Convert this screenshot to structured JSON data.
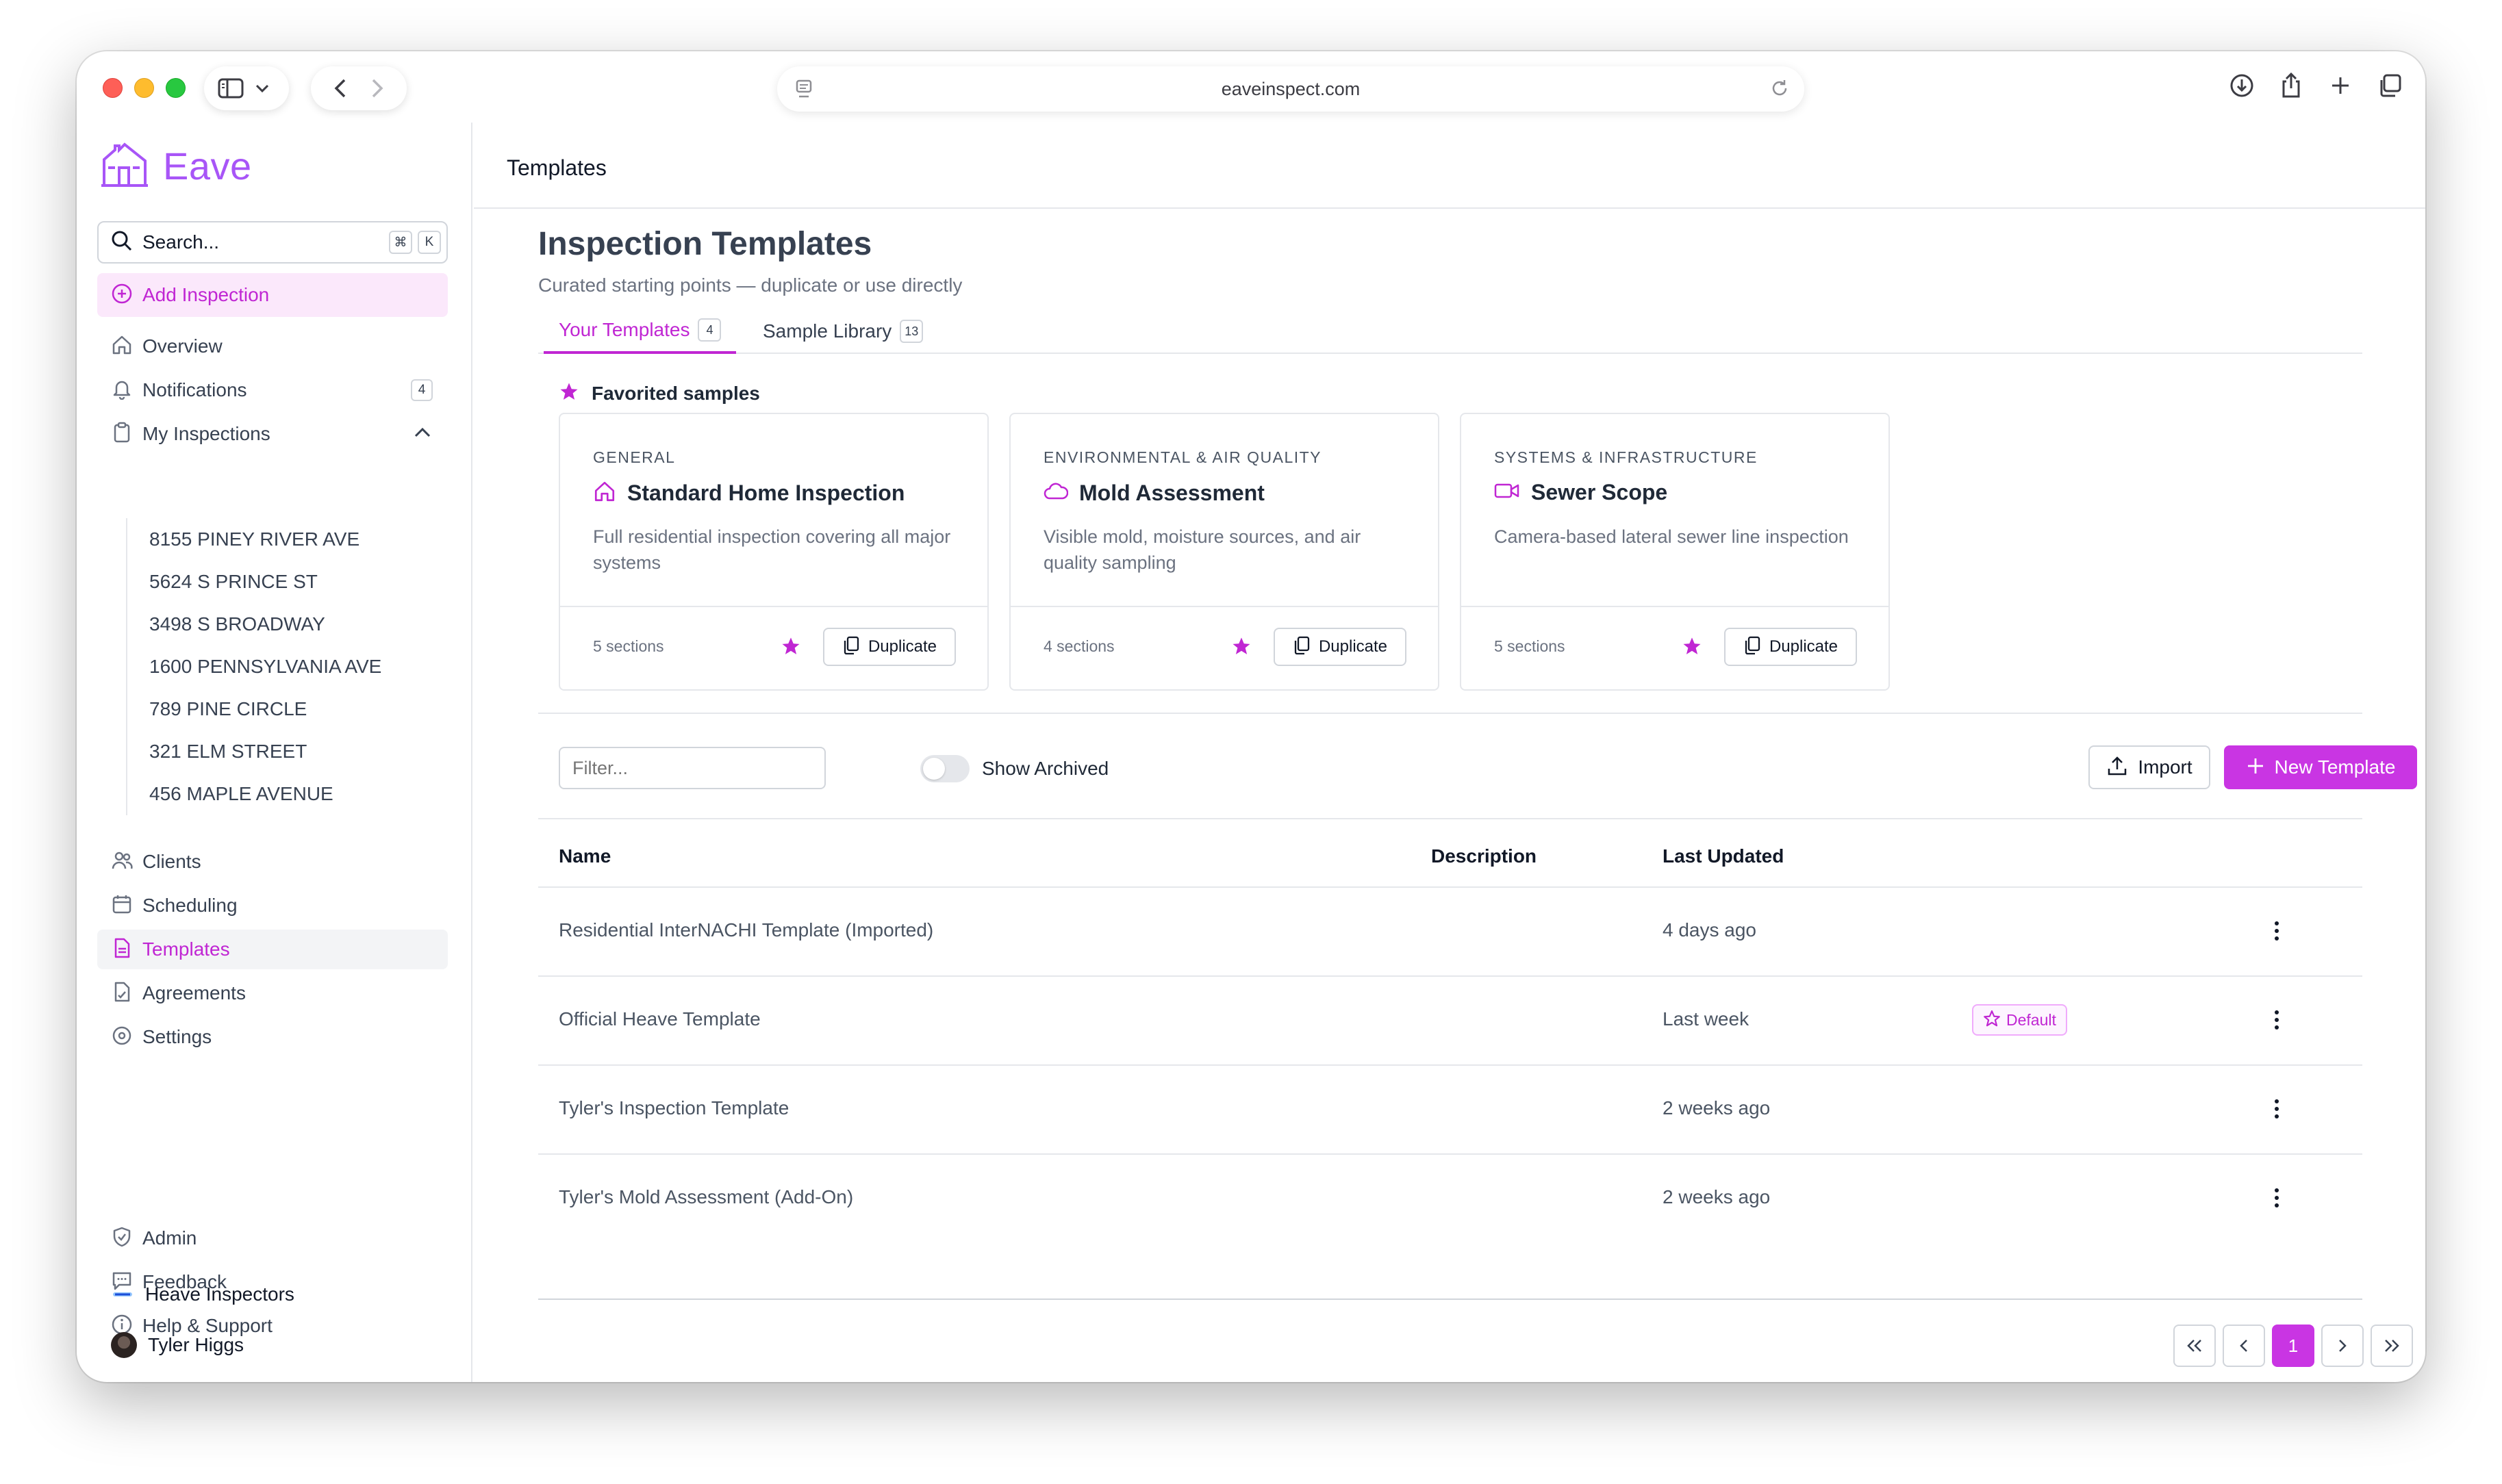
{
  "browser": {
    "url": "eaveinspect.com"
  },
  "sidebar": {
    "brand": "Eave",
    "search_placeholder": "Search...",
    "search_shortcut": [
      "⌘",
      "K"
    ],
    "add_inspection": "Add Inspection",
    "nav": {
      "overview": "Overview",
      "notifications": "Notifications",
      "notifications_count": "4",
      "my_inspections": "My Inspections",
      "clients": "Clients",
      "scheduling": "Scheduling",
      "templates": "Templates",
      "agreements": "Agreements",
      "settings": "Settings",
      "admin": "Admin",
      "feedback": "Feedback",
      "help": "Help & Support"
    },
    "inspections": [
      "8155 PINEY RIVER AVE",
      "5624 S PRINCE ST",
      "3498 S BROADWAY",
      "1600 PENNSYLVANIA AVE",
      "789 PINE CIRCLE",
      "321 ELM STREET",
      "456 MAPLE AVENUE"
    ],
    "organization": "Heave Inspectors",
    "user": "Tyler Higgs"
  },
  "header": {
    "title": "Templates"
  },
  "page": {
    "title": "Inspection Templates",
    "subtitle": "Curated starting points — duplicate or use directly"
  },
  "tabs": [
    {
      "label": "Your Templates",
      "count": "4"
    },
    {
      "label": "Sample Library",
      "count": "13"
    }
  ],
  "favorites": {
    "heading": "Favorited samples",
    "cards": [
      {
        "category": "GENERAL",
        "title": "Standard Home Inspection",
        "description": "Full residential inspection covering all major systems",
        "sections": "5 sections",
        "icon": "home-icon"
      },
      {
        "category": "ENVIRONMENTAL & AIR QUALITY",
        "title": "Mold Assessment",
        "description": "Visible mold, moisture sources, and air quality sampling",
        "sections": "4 sections",
        "icon": "cloud-icon"
      },
      {
        "category": "SYSTEMS & INFRASTRUCTURE",
        "title": "Sewer Scope",
        "description": "Camera-based lateral sewer line inspection",
        "sections": "5 sections",
        "icon": "video-icon"
      }
    ],
    "duplicate_label": "Duplicate"
  },
  "controls": {
    "filter_placeholder": "Filter...",
    "show_archived": "Show Archived",
    "import": "Import",
    "new_template": "New Template"
  },
  "table": {
    "headers": {
      "name": "Name",
      "description": "Description",
      "updated": "Last Updated"
    },
    "rows": [
      {
        "name": "Residential InterNACHI Template (Imported)",
        "updated": "4 days ago"
      },
      {
        "name": "Official Heave Template",
        "updated": "Last week",
        "badge": "Default"
      },
      {
        "name": "Tyler's Inspection Template",
        "updated": "2 weeks ago"
      },
      {
        "name": "Tyler's Mold Assessment (Add-On)",
        "updated": "2 weeks ago"
      }
    ]
  },
  "pagination": {
    "current_page": "1"
  },
  "colors": {
    "accent": "#c026d3",
    "brand": "#a855f7"
  }
}
